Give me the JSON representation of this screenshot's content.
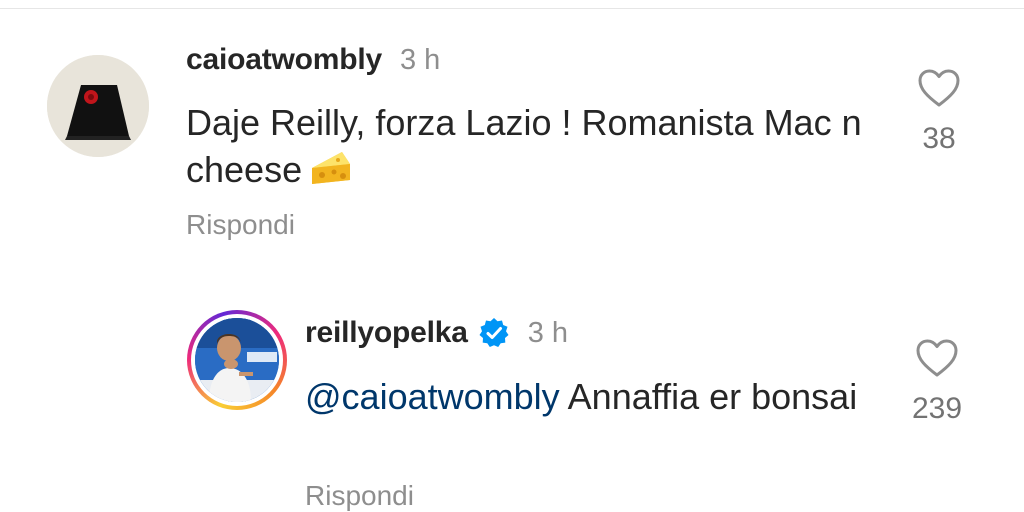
{
  "comments": [
    {
      "username": "caioatwombly",
      "time": "3 h",
      "text": "Daje Reilly, forza Lazio ! Romanista Mac n cheese",
      "emoji": "cheese-emoji",
      "reply_label": "Rispondi",
      "likes": "38",
      "verified": false
    },
    {
      "username": "reillyopelka",
      "time": "3 h",
      "mention": "@caioatwombly",
      "text": "Annaffia er bonsai",
      "reply_label": "Rispondi",
      "likes": "239",
      "verified": true
    }
  ],
  "colors": {
    "text": "#262626",
    "muted": "#8e8e8e",
    "mention": "#00376b",
    "verified": "#0095f6"
  }
}
